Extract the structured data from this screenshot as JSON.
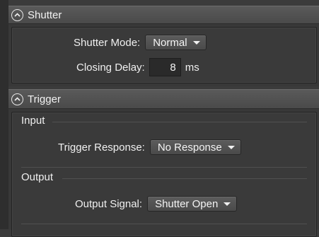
{
  "shutter": {
    "title": "Shutter",
    "mode_label": "Shutter Mode:",
    "mode_value": "Normal",
    "delay_label": "Closing Delay:",
    "delay_value": "8",
    "delay_unit": "ms"
  },
  "trigger": {
    "title": "Trigger",
    "input_title": "Input",
    "response_label": "Trigger Response:",
    "response_value": "No Response",
    "output_title": "Output",
    "signal_label": "Output Signal:",
    "signal_value": "Shutter Open"
  },
  "colors": {
    "background": "#3b3b3b",
    "header": "#505050",
    "text": "#f0f0f0"
  }
}
